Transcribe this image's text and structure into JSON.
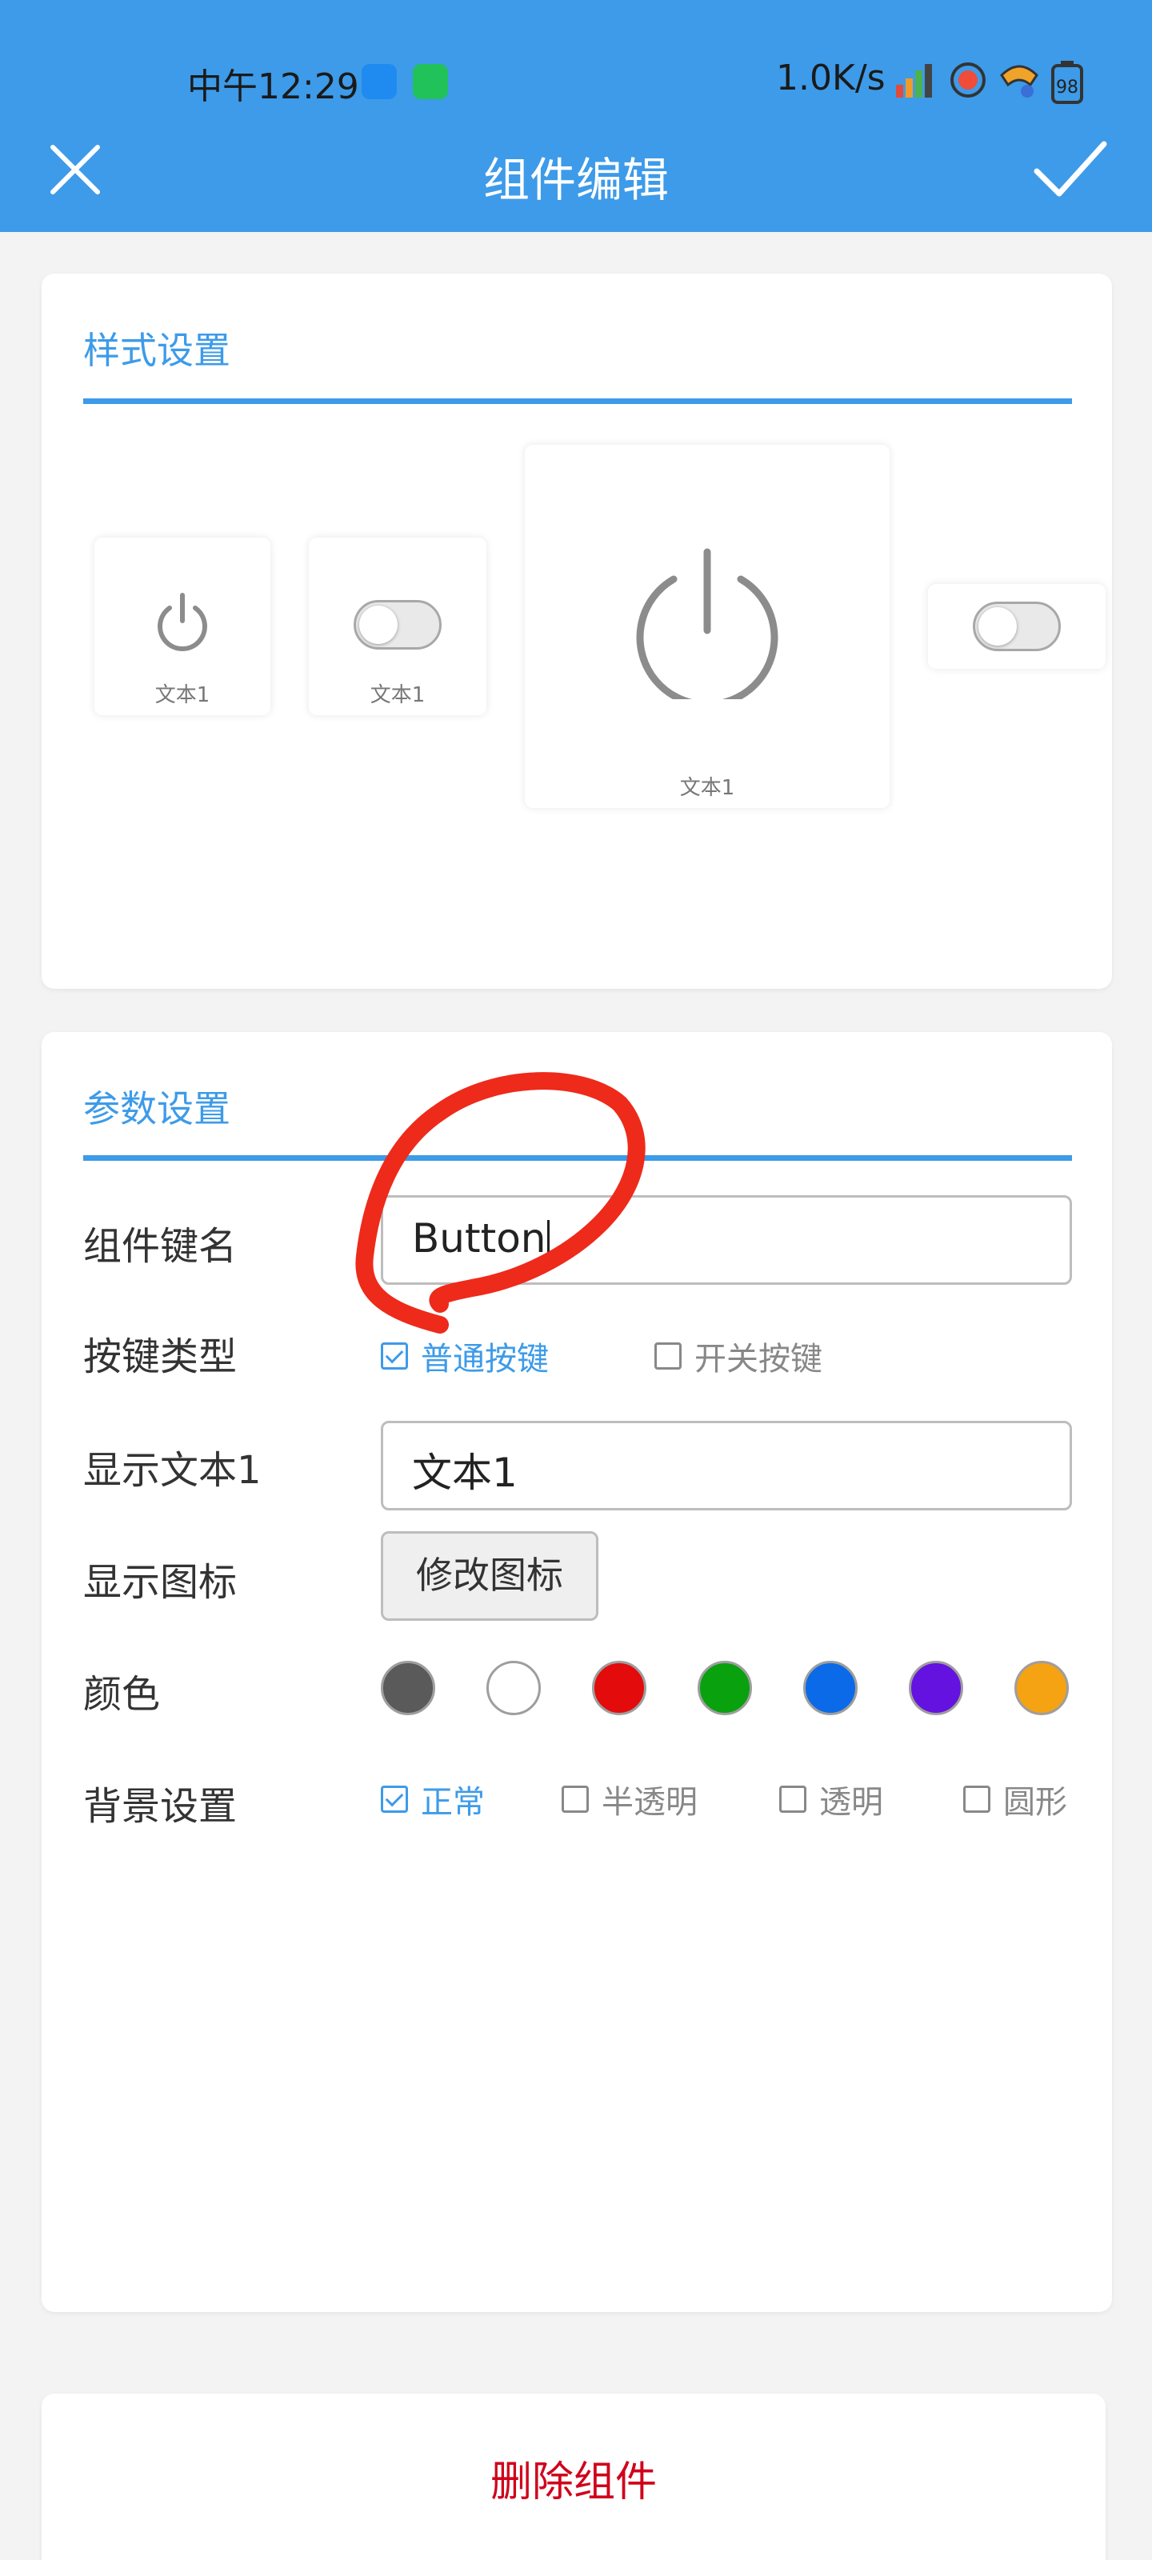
{
  "status_bar": {
    "time": "中午12:29",
    "network_speed": "1.0K/s",
    "battery_level": "98"
  },
  "header": {
    "title": "组件编辑",
    "close_icon": "close-icon",
    "confirm_icon": "check-icon",
    "background_color": "#3d9be9"
  },
  "style_section": {
    "title": "样式设置",
    "previews": [
      {
        "kind": "power-button-small",
        "caption": "文本1"
      },
      {
        "kind": "toggle-small",
        "caption": "文本1"
      },
      {
        "kind": "power-button-large",
        "caption": "文本1"
      },
      {
        "kind": "toggle-bar",
        "caption": ""
      }
    ]
  },
  "params_section": {
    "title": "参数设置",
    "key_name": {
      "label": "组件键名",
      "value": "Button"
    },
    "key_type": {
      "label": "按键类型",
      "options": [
        {
          "label": "普通按键",
          "checked": true
        },
        {
          "label": "开关按键",
          "checked": false
        }
      ]
    },
    "display_text": {
      "label": "显示文本1",
      "value": "文本1"
    },
    "display_icon": {
      "label": "显示图标",
      "button_label": "修改图标"
    },
    "color": {
      "label": "颜色",
      "swatches": [
        "#5a5a5a",
        "#ffffff",
        "#e30b0b",
        "#0aa10f",
        "#0b6ae8",
        "#6412e0",
        "#f5a312"
      ]
    },
    "background": {
      "label": "背景设置",
      "options": [
        {
          "label": "正常",
          "checked": true
        },
        {
          "label": "半透明",
          "checked": false
        },
        {
          "label": "透明",
          "checked": false
        },
        {
          "label": "圆形",
          "checked": false
        }
      ]
    }
  },
  "delete_button": {
    "label": "删除组件",
    "color": "#d0021b"
  },
  "annotation": {
    "kind": "red-hand-drawn-circle",
    "color": "#ee2a1b"
  }
}
